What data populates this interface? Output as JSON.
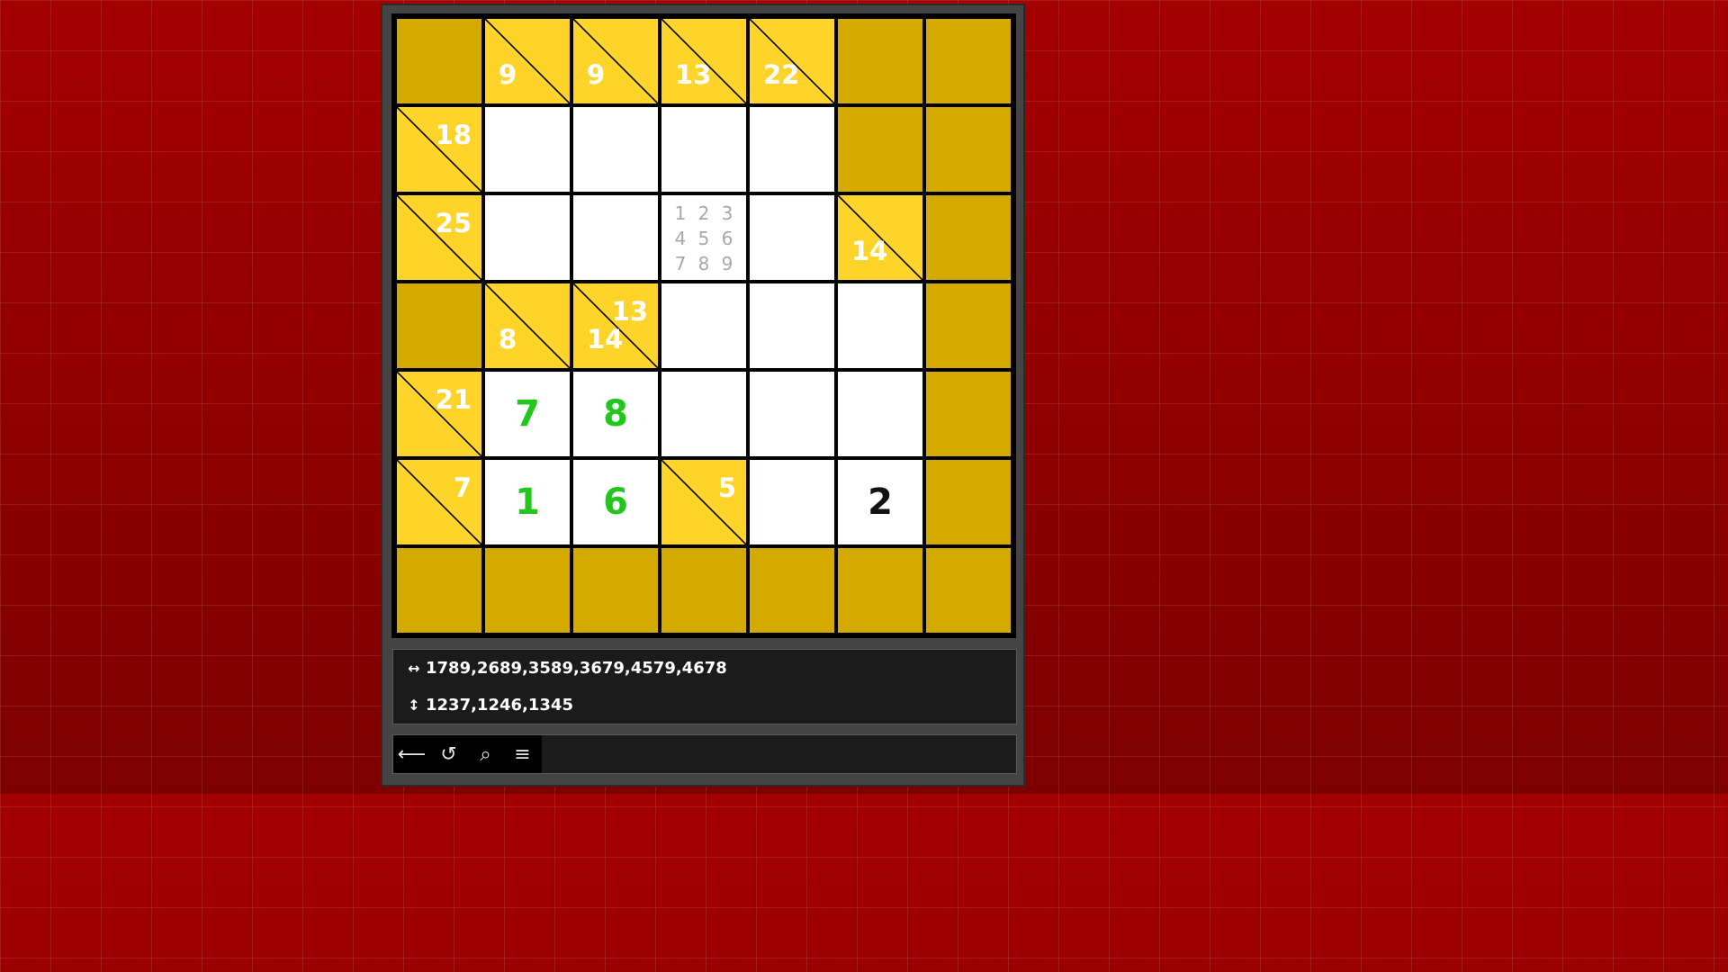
{
  "board": {
    "cells": [
      [
        {
          "t": "block"
        },
        {
          "t": "clue",
          "down": "9"
        },
        {
          "t": "clue",
          "down": "9"
        },
        {
          "t": "clue",
          "down": "13"
        },
        {
          "t": "clue",
          "down": "22"
        },
        {
          "t": "block"
        },
        {
          "t": "block"
        }
      ],
      [
        {
          "t": "clue",
          "across": "18"
        },
        {
          "t": "white"
        },
        {
          "t": "white"
        },
        {
          "t": "white"
        },
        {
          "t": "white"
        },
        {
          "t": "block"
        },
        {
          "t": "block"
        }
      ],
      [
        {
          "t": "clue",
          "across": "25"
        },
        {
          "t": "white"
        },
        {
          "t": "white"
        },
        {
          "t": "white",
          "pencil": [
            "1",
            "2",
            "3",
            "4",
            "5",
            "6",
            "7",
            "8",
            "9"
          ]
        },
        {
          "t": "white"
        },
        {
          "t": "clue",
          "down": "14"
        },
        {
          "t": "block"
        }
      ],
      [
        {
          "t": "block"
        },
        {
          "t": "clue",
          "down": "8"
        },
        {
          "t": "clue",
          "across": "13",
          "down": "14"
        },
        {
          "t": "white"
        },
        {
          "t": "white"
        },
        {
          "t": "white"
        },
        {
          "t": "block"
        }
      ],
      [
        {
          "t": "clue",
          "across": "21"
        },
        {
          "t": "white",
          "value": "7",
          "state": "correct"
        },
        {
          "t": "white",
          "value": "8",
          "state": "correct"
        },
        {
          "t": "white"
        },
        {
          "t": "white"
        },
        {
          "t": "white"
        },
        {
          "t": "block"
        }
      ],
      [
        {
          "t": "clue",
          "across": "7"
        },
        {
          "t": "white",
          "value": "1",
          "state": "correct"
        },
        {
          "t": "white",
          "value": "6",
          "state": "correct"
        },
        {
          "t": "clue",
          "across": "5"
        },
        {
          "t": "white"
        },
        {
          "t": "white",
          "value": "2",
          "state": "plain"
        },
        {
          "t": "block"
        }
      ],
      [
        {
          "t": "block"
        },
        {
          "t": "block"
        },
        {
          "t": "block"
        },
        {
          "t": "block"
        },
        {
          "t": "block"
        },
        {
          "t": "block"
        },
        {
          "t": "block"
        }
      ]
    ]
  },
  "info": {
    "across_icon": "↔",
    "across_combos": "1789,2689,3589,3679,4579,4678",
    "down_icon": "↕",
    "down_combos": "1237,1246,1345"
  },
  "toolbar": {
    "back": {
      "glyph": "⟵",
      "icon": "back-arrow-icon"
    },
    "undo": {
      "glyph": "↺",
      "icon": "undo-icon"
    },
    "search": {
      "glyph": "⌕",
      "icon": "search-icon"
    },
    "menu": {
      "glyph": "≡",
      "icon": "menu-icon"
    }
  },
  "colors": {
    "block": "#d4aa00",
    "clue": "#ffd42a",
    "correct": "#22c61c",
    "background": "#8d0000"
  }
}
